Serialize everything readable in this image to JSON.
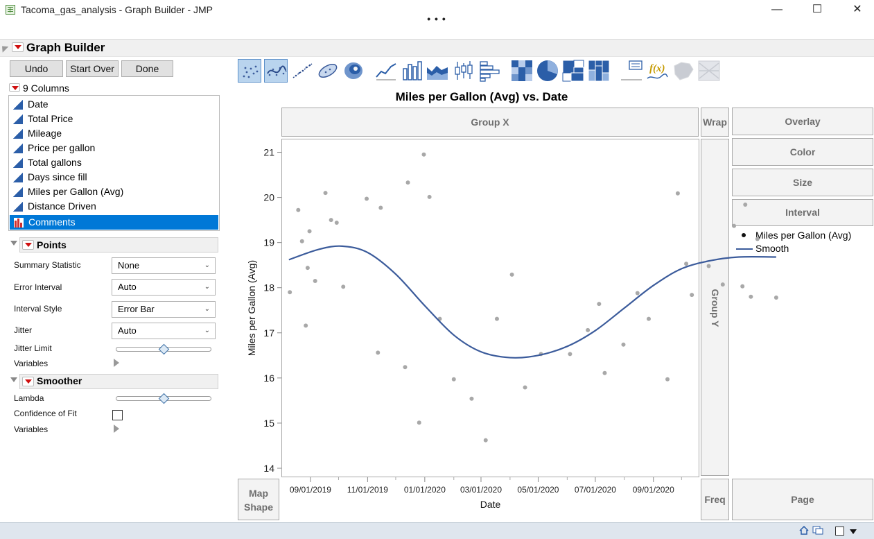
{
  "window": {
    "title": "Tacoma_gas_analysis - Graph Builder - JMP",
    "minimize_glyph": "—",
    "maximize_glyph": "☐",
    "close_glyph": "✕",
    "overflow_glyph": "• • •"
  },
  "header": {
    "title": "Graph Builder"
  },
  "buttons": {
    "undo": "Undo",
    "start_over": "Start Over",
    "done": "Done"
  },
  "columns": {
    "label": "9 Columns",
    "items": [
      {
        "label": "Date",
        "icon": "continuous-icon"
      },
      {
        "label": "Total Price",
        "icon": "continuous-icon"
      },
      {
        "label": "Mileage",
        "icon": "continuous-icon"
      },
      {
        "label": "Price per gallon",
        "icon": "continuous-icon"
      },
      {
        "label": "Total gallons",
        "icon": "continuous-icon"
      },
      {
        "label": "Days since fill",
        "icon": "continuous-icon"
      },
      {
        "label": "Miles per Gallon (Avg)",
        "icon": "continuous-icon"
      },
      {
        "label": "Distance Driven",
        "icon": "continuous-icon"
      },
      {
        "label": "Comments",
        "icon": "nominal-icon",
        "selected": true
      }
    ]
  },
  "points": {
    "title": "Points",
    "summary_statistic_label": "Summary Statistic",
    "summary_statistic_value": "None",
    "error_interval_label": "Error Interval",
    "error_interval_value": "Auto",
    "interval_style_label": "Interval Style",
    "interval_style_value": "Error Bar",
    "jitter_label": "Jitter",
    "jitter_value": "Auto",
    "jitter_limit_label": "Jitter Limit",
    "variables_label": "Variables"
  },
  "smoother": {
    "title": "Smoother",
    "lambda_label": "Lambda",
    "confidence_label": "Confidence of Fit",
    "confidence_checked": false,
    "variables_label": "Variables"
  },
  "toolbar": {
    "icons": [
      "points-icon",
      "smoother-icon",
      "line-of-fit-icon",
      "ellipse-icon",
      "contour-icon",
      "line-icon",
      "bar-icon",
      "area-icon",
      "box-plot-icon",
      "histogram-icon",
      "heatmap-icon",
      "pie-icon",
      "treemap-icon",
      "mosaic-icon",
      "caption-box-icon",
      "formula-icon",
      "map-shapes-icon",
      "parallel-icon"
    ]
  },
  "zones": {
    "group_x": "Group X",
    "wrap": "Wrap",
    "overlay": "Overlay",
    "color": "Color",
    "size": "Size",
    "interval": "Interval",
    "group_y": "Group Y",
    "map_shape_line1": "Map",
    "map_shape_line2": "Shape",
    "freq": "Freq",
    "page": "Page"
  },
  "legend": {
    "items": [
      {
        "label": "Miles per Gallon (Avg)",
        "symbol": "dot"
      },
      {
        "label": "Smooth",
        "symbol": "line"
      }
    ]
  },
  "colors": {
    "accent_selection": "#0078d7",
    "smooth_line": "#3b5b9b",
    "points": "#a8a8a8"
  },
  "chart_data": {
    "type": "scatter",
    "title": "Miles per Gallon (Avg) vs. Date",
    "xlabel": "Date",
    "ylabel": "Miles per Gallon (Avg)",
    "xlim": [
      "2019-08-01",
      "2020-10-20"
    ],
    "ylim": [
      13.8,
      21.3
    ],
    "x_ticks": [
      "09/01/2019",
      "11/01/2019",
      "01/01/2020",
      "03/01/2020",
      "05/01/2020",
      "07/01/2020",
      "09/01/2020"
    ],
    "y_ticks": [
      14,
      15,
      16,
      17,
      18,
      19,
      20,
      21
    ],
    "grid": false,
    "series": [
      {
        "name": "Miles per Gallon (Avg)",
        "kind": "points",
        "points": [
          [
            "2019-08-10",
            17.9
          ],
          [
            "2019-08-19",
            19.72
          ],
          [
            "2019-08-23",
            19.03
          ],
          [
            "2019-08-27",
            17.16
          ],
          [
            "2019-08-29",
            18.44
          ],
          [
            "2019-08-31",
            19.25
          ],
          [
            "2019-09-06",
            18.15
          ],
          [
            "2019-09-17",
            20.1
          ],
          [
            "2019-09-23",
            19.5
          ],
          [
            "2019-09-29",
            19.44
          ],
          [
            "2019-10-06",
            18.02
          ],
          [
            "2019-10-31",
            19.97
          ],
          [
            "2019-11-12",
            16.56
          ],
          [
            "2019-11-15",
            19.77
          ],
          [
            "2019-12-11",
            16.24
          ],
          [
            "2019-12-14",
            20.33
          ],
          [
            "2019-12-26",
            15.01
          ],
          [
            "2019-12-31",
            20.95
          ],
          [
            "2020-01-06",
            20.01
          ],
          [
            "2020-01-17",
            17.31
          ],
          [
            "2020-02-01",
            15.97
          ],
          [
            "2020-02-20",
            15.54
          ],
          [
            "2020-03-06",
            14.62
          ],
          [
            "2020-03-18",
            17.31
          ],
          [
            "2020-04-03",
            18.29
          ],
          [
            "2020-04-17",
            15.79
          ],
          [
            "2020-05-04",
            16.53
          ],
          [
            "2020-06-04",
            16.53
          ],
          [
            "2020-06-23",
            17.06
          ],
          [
            "2020-07-05",
            17.64
          ],
          [
            "2020-07-11",
            16.11
          ],
          [
            "2020-07-31",
            16.74
          ],
          [
            "2020-08-15",
            17.88
          ],
          [
            "2020-08-27",
            17.31
          ],
          [
            "2020-09-16",
            15.97
          ],
          [
            "2020-09-27",
            20.09
          ],
          [
            "2020-10-06",
            18.53
          ],
          [
            "2020-10-12",
            17.84
          ],
          [
            "2020-10-30",
            18.48
          ],
          [
            "2020-11-14",
            18.07
          ],
          [
            "2020-11-26",
            19.37
          ],
          [
            "2020-12-05",
            18.03
          ],
          [
            "2020-12-08",
            19.84
          ],
          [
            "2020-12-14",
            17.8
          ],
          [
            "2020-12-21",
            19.08
          ],
          [
            "2021-01-10",
            17.78
          ]
        ]
      },
      {
        "name": "Smooth",
        "kind": "line",
        "points": [
          [
            "2019-08-09",
            18.62
          ],
          [
            "2019-09-10",
            18.85
          ],
          [
            "2019-10-05",
            18.92
          ],
          [
            "2019-11-01",
            18.78
          ],
          [
            "2019-12-01",
            18.3
          ],
          [
            "2020-01-01",
            17.6
          ],
          [
            "2020-02-01",
            16.95
          ],
          [
            "2020-03-01",
            16.58
          ],
          [
            "2020-04-01",
            16.45
          ],
          [
            "2020-05-01",
            16.5
          ],
          [
            "2020-06-01",
            16.7
          ],
          [
            "2020-07-01",
            17.05
          ],
          [
            "2020-08-01",
            17.55
          ],
          [
            "2020-09-01",
            18.05
          ],
          [
            "2020-10-01",
            18.42
          ],
          [
            "2020-11-01",
            18.6
          ],
          [
            "2020-12-01",
            18.68
          ],
          [
            "2021-01-10",
            18.68
          ]
        ]
      }
    ]
  }
}
